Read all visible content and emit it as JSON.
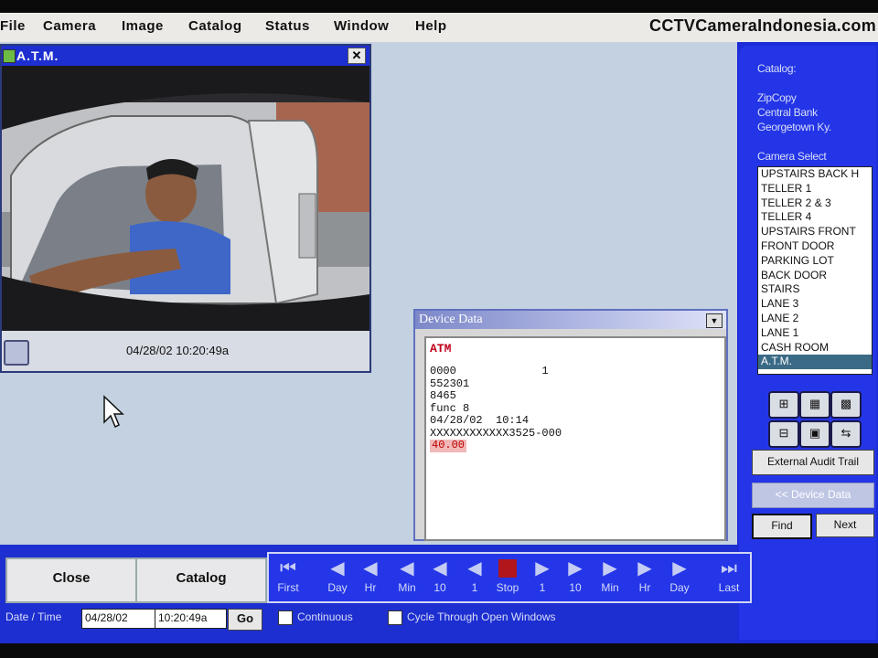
{
  "menu": {
    "items": [
      "File",
      "Camera",
      "Image",
      "Catalog",
      "Status",
      "Window",
      "Help"
    ],
    "site": "CCTVCameraIndonesia.com"
  },
  "camera_window": {
    "title": "A.T.M.",
    "close": "✕",
    "timestamp": "04/28/02 10:20:49a"
  },
  "device_window": {
    "title": "Device Data",
    "heading": "ATM",
    "lines": [
      "0000             1",
      "552301",
      "8465",
      "func 8",
      "04/28/02  10:14",
      "XXXXXXXXXXXX3525-000"
    ],
    "amount": "40.00"
  },
  "right_panel": {
    "catalog_label": "Catalog:",
    "catalog_lines": [
      "ZipCopy",
      "Central Bank",
      "Georgetown Ky."
    ],
    "camera_select_label": "Camera Select",
    "cameras": [
      "UPSTAIRS BACK H",
      "TELLER 1",
      "TELLER 2 & 3",
      "TELLER 4",
      "UPSTAIRS FRONT",
      "FRONT DOOR",
      "PARKING LOT",
      "BACK DOOR",
      "STAIRS",
      "LANE 3",
      "LANE 2",
      "LANE 1",
      "CASH ROOM",
      "A.T.M."
    ],
    "selected_camera": "A.T.M.",
    "external_audit": "External Audit Trail",
    "device_data_btn": "<< Device Data",
    "find": "Find",
    "next": "Next"
  },
  "bottom": {
    "close": "Close",
    "catalog": "Catalog",
    "date_time_label": "Date / Time",
    "date_value": "04/28/02",
    "time_value": "10:20:49a",
    "go": "Go",
    "continuous": "Continuous",
    "cycle": "Cycle Through Open Windows"
  },
  "transport": [
    {
      "label": "First",
      "icon": "first-icon"
    },
    {
      "label": "Day",
      "icon": "rewind-icon"
    },
    {
      "label": "Hr",
      "icon": "rewind-icon"
    },
    {
      "label": "Min",
      "icon": "rewind-icon"
    },
    {
      "label": "10",
      "icon": "rewind-icon"
    },
    {
      "label": "1",
      "icon": "rewind-icon"
    },
    {
      "label": "Stop",
      "icon": "stop-icon"
    },
    {
      "label": "1",
      "icon": "play-icon"
    },
    {
      "label": "10",
      "icon": "play-icon"
    },
    {
      "label": "Min",
      "icon": "play-icon"
    },
    {
      "label": "Hr",
      "icon": "play-icon"
    },
    {
      "label": "Day",
      "icon": "play-icon"
    },
    {
      "label": "Last",
      "icon": "last-icon"
    }
  ]
}
